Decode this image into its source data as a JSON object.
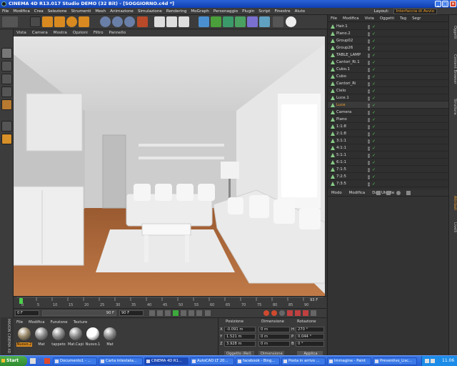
{
  "window": {
    "title": "CINEMA 4D R13.017 Studio DEMO (32 Bit) - [SOGGIORNO.c4d *]"
  },
  "menubar": [
    "File",
    "Modifica",
    "Crea",
    "Selezione",
    "Strumenti",
    "Mesh",
    "Animazione",
    "Simulazione",
    "Rendering",
    "MoGraph",
    "Personaggio",
    "Plugin",
    "Script",
    "Finestre",
    "Aiuto"
  ],
  "layout": {
    "label": "Layout:",
    "value": "Interfaccia di Avvio"
  },
  "viewport_menu": [
    "Vista",
    "Camera",
    "Mostra",
    "Opzioni",
    "Filtro",
    "Pannello"
  ],
  "objects_menu": [
    "File",
    "Modifica",
    "Vista",
    "Oggetti",
    "Tag",
    "Segr"
  ],
  "objects": [
    {
      "name": "Hair.1"
    },
    {
      "name": "Piano.2"
    },
    {
      "name": "Group02"
    },
    {
      "name": "Group26"
    },
    {
      "name": "TABLE_LAMP"
    },
    {
      "name": "Cantori_Ri.1"
    },
    {
      "name": "Cubo.1"
    },
    {
      "name": "Cubo"
    },
    {
      "name": "Cantori_Ri"
    },
    {
      "name": "Cielo"
    },
    {
      "name": "Luce.1"
    },
    {
      "name": "Luce",
      "highlight": true
    },
    {
      "name": "Camera"
    },
    {
      "name": "Piano"
    },
    {
      "name": "1:1:8"
    },
    {
      "name": "2:1:8"
    },
    {
      "name": "3:1:1"
    },
    {
      "name": "4:1:1"
    },
    {
      "name": "5:1:1"
    },
    {
      "name": "6:1:1"
    },
    {
      "name": "7:1:5"
    },
    {
      "name": "7:2:5"
    },
    {
      "name": "7:3:5"
    }
  ],
  "attributes_menu": [
    "Modo",
    "Modifica",
    "Dati Utente"
  ],
  "side_tabs_top": [
    "Oggetti",
    "Content Browser",
    "Struttura"
  ],
  "side_tabs_bottom": [
    "Attributi",
    "Livelli"
  ],
  "timeline": {
    "ticks": [
      "0",
      "5",
      "10",
      "15",
      "20",
      "25",
      "30",
      "35",
      "40",
      "45",
      "50",
      "55",
      "60",
      "65",
      "70",
      "75",
      "80",
      "85",
      "90"
    ],
    "end_label": "93 F",
    "current": "0 F"
  },
  "transport": {
    "start": "0 F",
    "slider_end": "90 F",
    "end": "90 F"
  },
  "materials_menu": [
    "File",
    "Modifica",
    "Funzione",
    "Texture"
  ],
  "materials": [
    {
      "name": "Nuovo.2",
      "color": "#9a8a6a",
      "selected": true
    },
    {
      "name": "Mat"
    },
    {
      "name": "tappeto"
    },
    {
      "name": "Mat.Capi"
    },
    {
      "name": "Nuovo.1",
      "color": "#ffffff"
    },
    {
      "name": "Mat"
    }
  ],
  "coords": {
    "headers": [
      "Posizione",
      "Dimensione",
      "Rotazione"
    ],
    "rows": [
      {
        "axis": "X",
        "pos": "-0.091 m",
        "dim": "0 m",
        "rot_label": "H",
        "rot": "270 °"
      },
      {
        "axis": "Y",
        "pos": "1.521 m",
        "dim": "0 m",
        "rot_label": "P",
        "rot": "0.044 °"
      },
      {
        "axis": "Z",
        "pos": "3.928 m",
        "dim": "0 m",
        "rot_label": "B",
        "rot": "0 °"
      }
    ],
    "mode": "Oggetto (Rel)",
    "size_mode": "Dimensione",
    "apply": "Applica"
  },
  "maxon_brand": "MAXON CINEMA 4D",
  "taskbar": {
    "start": "Start",
    "items": [
      {
        "label": "Documento1 - ...",
        "active": false
      },
      {
        "label": "Carta intestata...",
        "active": false
      },
      {
        "label": "CINEMA 4D R1...",
        "active": true
      },
      {
        "label": "AutoCAD LT 20...",
        "active": false
      },
      {
        "label": "facebook - Bing...",
        "active": false
      },
      {
        "label": "Posta in arrivo ...",
        "active": false
      },
      {
        "label": "Immagine - Paint",
        "active": false
      },
      {
        "label": "Preventivo_Lisc...",
        "active": false
      }
    ],
    "clock": "11.06"
  }
}
